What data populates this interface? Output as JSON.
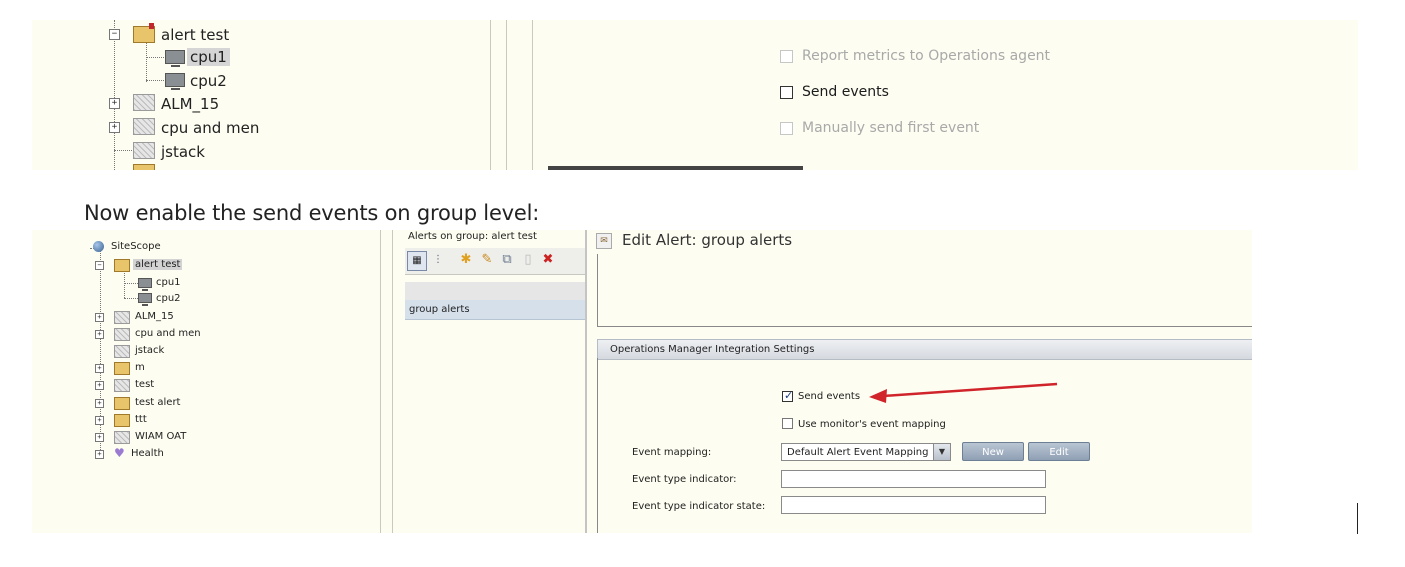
{
  "top": {
    "tree": [
      {
        "label": "alert test",
        "expanded": true
      },
      {
        "label": "cpu1",
        "selected": true
      },
      {
        "label": "cpu2"
      },
      {
        "label": "ALM_15"
      },
      {
        "label": "cpu and men"
      },
      {
        "label": "jstack"
      }
    ],
    "options": [
      {
        "label": "Report metrics to Operations agent",
        "checked": false,
        "enabled": false
      },
      {
        "label": "Send events",
        "checked": false,
        "enabled": true
      },
      {
        "label": "Manually send first event",
        "checked": false,
        "enabled": false
      }
    ]
  },
  "caption": "Now enable the send events on group level:",
  "bottom": {
    "tree": [
      {
        "label": "SiteScope"
      },
      {
        "label": "alert test",
        "selected": true
      },
      {
        "label": "cpu1"
      },
      {
        "label": "cpu2"
      },
      {
        "label": "ALM_15"
      },
      {
        "label": "cpu and men"
      },
      {
        "label": "jstack"
      },
      {
        "label": "m"
      },
      {
        "label": "test"
      },
      {
        "label": "test alert"
      },
      {
        "label": "ttt"
      },
      {
        "label": "WIAM OAT"
      },
      {
        "label": "Health"
      }
    ],
    "alerts_panel": {
      "title": "Alerts on group: alert test",
      "rows": [
        "group alerts"
      ]
    },
    "edit_alert_title": "Edit Alert: group alerts",
    "section_title": "Operations Manager Integration Settings",
    "send_events": {
      "label": "Send events",
      "checked": true
    },
    "use_monitor_mapping": {
      "label": "Use monitor's event mapping",
      "checked": false
    },
    "event_mapping": {
      "label": "Event mapping:",
      "value": "Default Alert Event Mapping"
    },
    "buttons": {
      "new": "New",
      "edit": "Edit"
    },
    "event_type_indicator": {
      "label": "Event type indicator:",
      "value": ""
    },
    "event_type_indicator_state": {
      "label": "Event type indicator state:",
      "value": ""
    },
    "arrow_color": "#d0242a"
  }
}
